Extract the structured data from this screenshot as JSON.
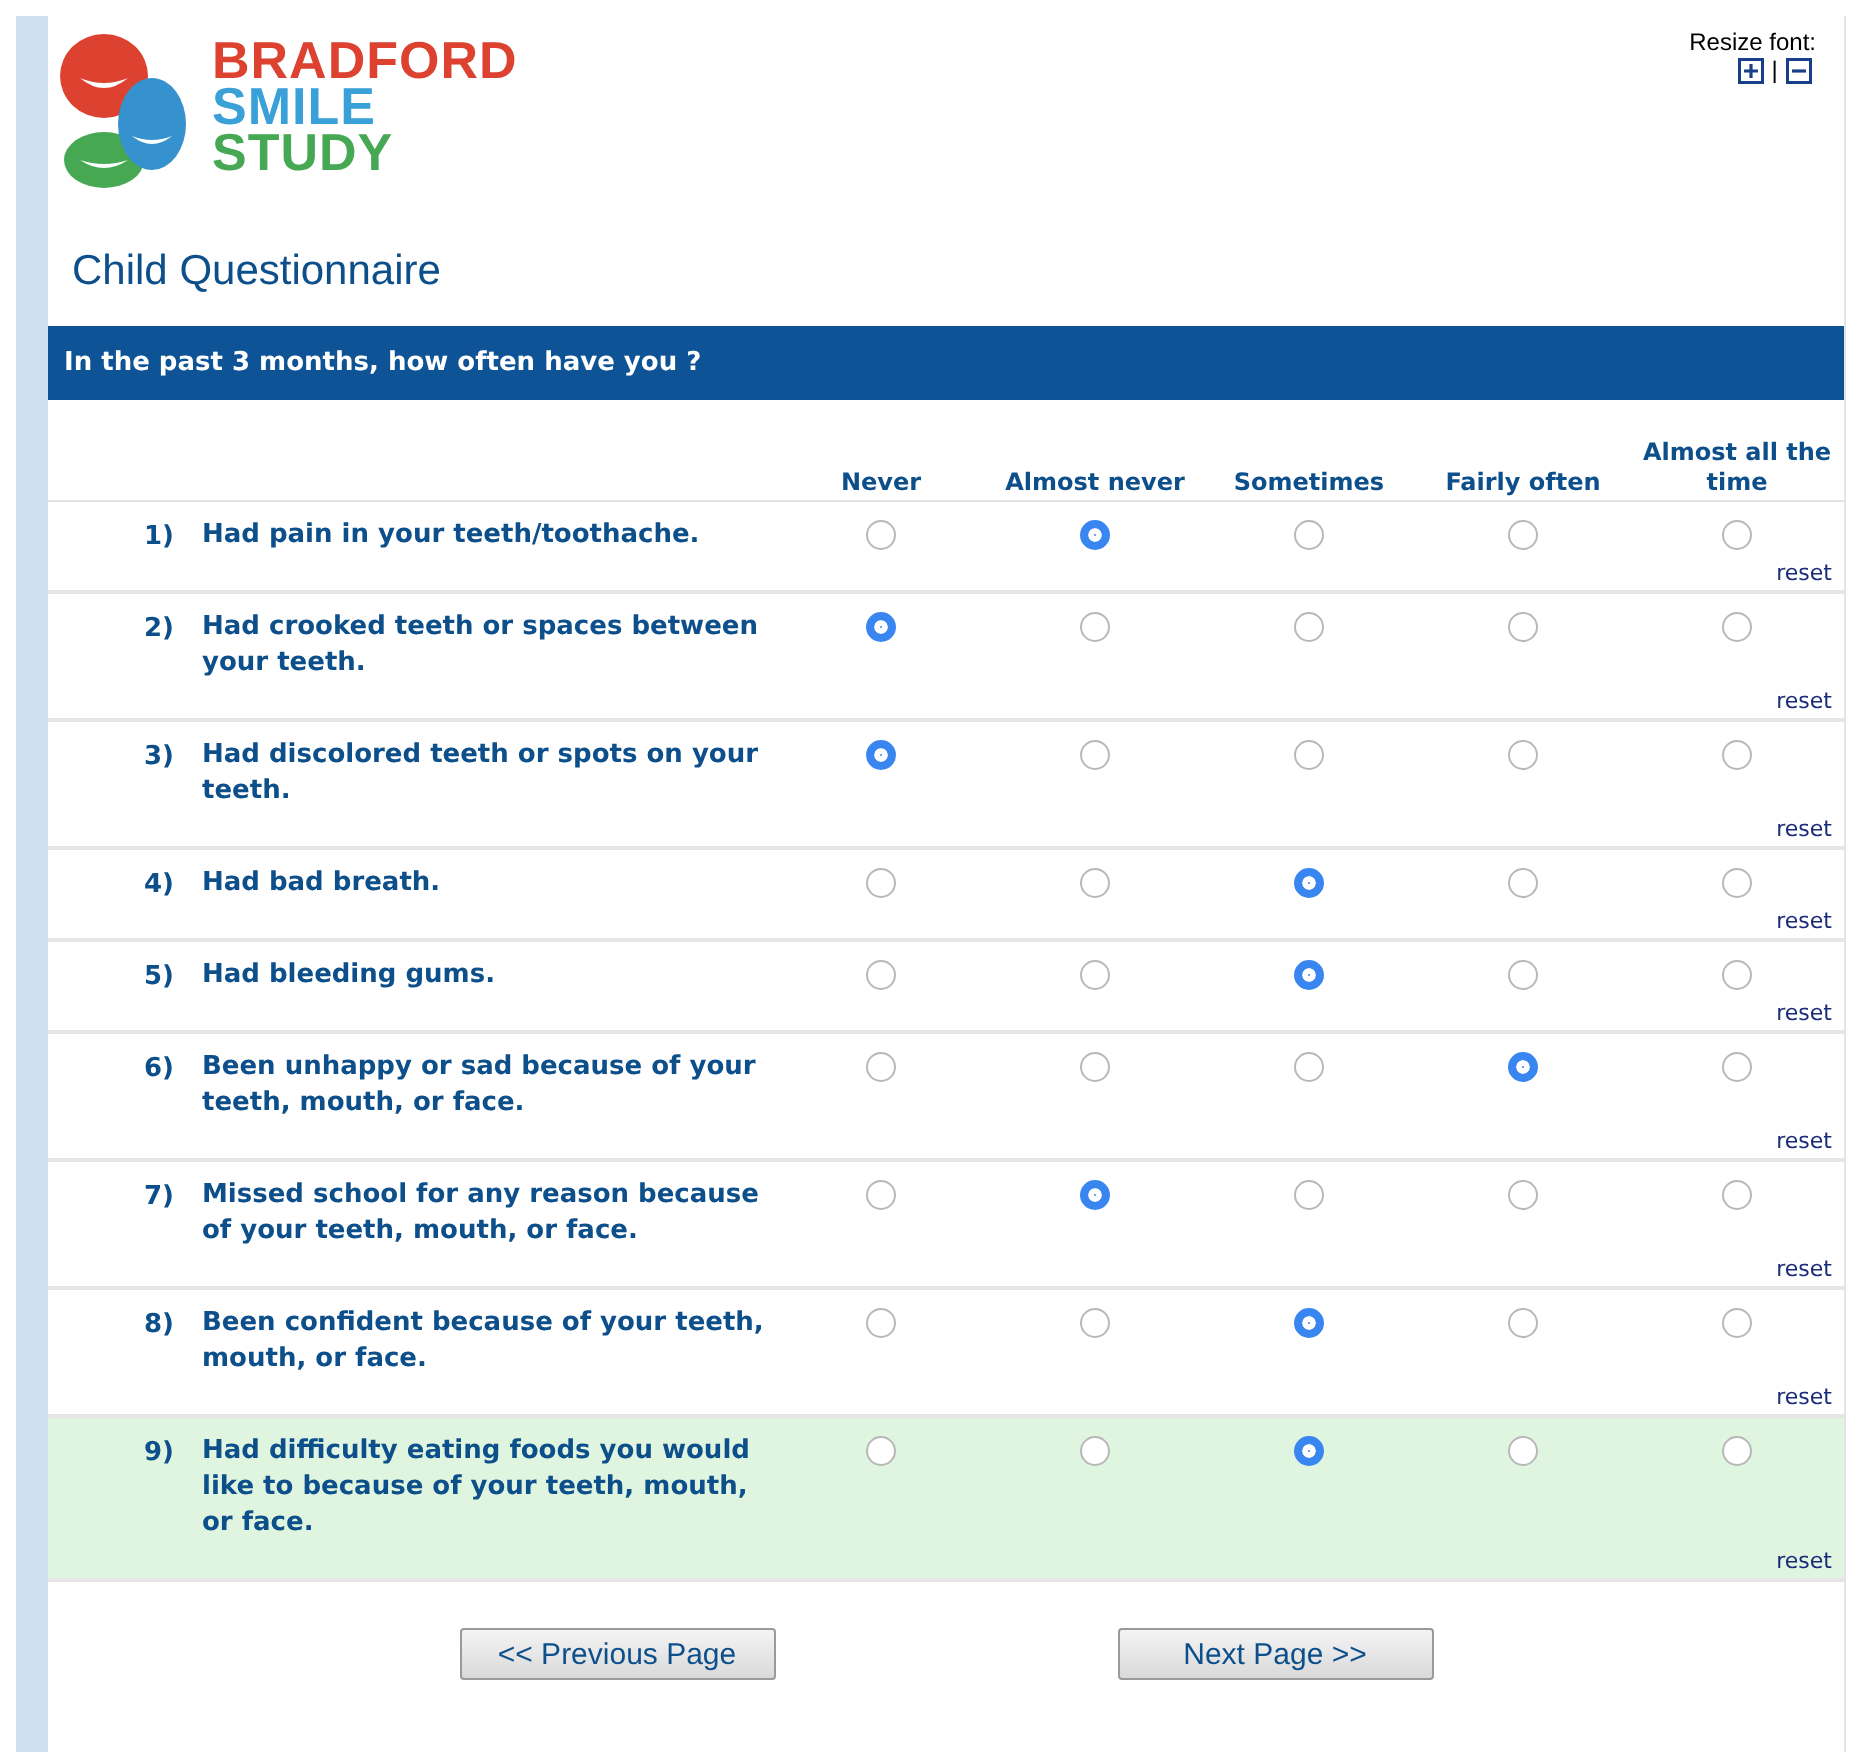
{
  "logo": {
    "lines": [
      "BRADFORD",
      "SMILE",
      "STUDY"
    ]
  },
  "resize_font": {
    "label": "Resize font:",
    "separator": "|"
  },
  "title": "Child Questionnaire",
  "section": {
    "heading": "In the past 3 months, how often have you ?"
  },
  "columns": [
    "Never",
    "Almost never",
    "Sometimes",
    "Fairly often",
    "Almost all the time"
  ],
  "rows": [
    {
      "number": "1)",
      "question": "Had pain in your teeth/toothache.",
      "highlighted": false,
      "choices": [
        {
          "selected": false
        },
        {
          "selected": true
        },
        {
          "selected": false
        },
        {
          "selected": false
        },
        {
          "selected": false
        }
      ],
      "reset": "reset"
    },
    {
      "number": "2)",
      "question": "Had crooked teeth or spaces between your teeth.",
      "highlighted": false,
      "choices": [
        {
          "selected": true
        },
        {
          "selected": false
        },
        {
          "selected": false
        },
        {
          "selected": false
        },
        {
          "selected": false
        }
      ],
      "reset": "reset"
    },
    {
      "number": "3)",
      "question": "Had discolored teeth or spots on your teeth.",
      "highlighted": false,
      "choices": [
        {
          "selected": true
        },
        {
          "selected": false
        },
        {
          "selected": false
        },
        {
          "selected": false
        },
        {
          "selected": false
        }
      ],
      "reset": "reset"
    },
    {
      "number": "4)",
      "question": "Had bad breath.",
      "highlighted": false,
      "choices": [
        {
          "selected": false
        },
        {
          "selected": false
        },
        {
          "selected": true
        },
        {
          "selected": false
        },
        {
          "selected": false
        }
      ],
      "reset": "reset"
    },
    {
      "number": "5)",
      "question": "Had bleeding gums.",
      "highlighted": false,
      "choices": [
        {
          "selected": false
        },
        {
          "selected": false
        },
        {
          "selected": true
        },
        {
          "selected": false
        },
        {
          "selected": false
        }
      ],
      "reset": "reset"
    },
    {
      "number": "6)",
      "question": "Been unhappy or sad because of your teeth, mouth, or face.",
      "highlighted": false,
      "choices": [
        {
          "selected": false
        },
        {
          "selected": false
        },
        {
          "selected": false
        },
        {
          "selected": true
        },
        {
          "selected": false
        }
      ],
      "reset": "reset"
    },
    {
      "number": "7)",
      "question": "Missed school for any reason because of your teeth, mouth, or face.",
      "highlighted": false,
      "choices": [
        {
          "selected": false
        },
        {
          "selected": true
        },
        {
          "selected": false
        },
        {
          "selected": false
        },
        {
          "selected": false
        }
      ],
      "reset": "reset"
    },
    {
      "number": "8)",
      "question": "Been confident because of your teeth, mouth, or face.",
      "highlighted": false,
      "choices": [
        {
          "selected": false
        },
        {
          "selected": false
        },
        {
          "selected": true
        },
        {
          "selected": false
        },
        {
          "selected": false
        }
      ],
      "reset": "reset"
    },
    {
      "number": "9)",
      "question": "Had difficulty eating foods you would like to because of your teeth, mouth, or face.",
      "highlighted": true,
      "choices": [
        {
          "selected": false
        },
        {
          "selected": false
        },
        {
          "selected": true
        },
        {
          "selected": false
        },
        {
          "selected": false
        }
      ],
      "reset": "reset"
    }
  ],
  "buttons": [
    {
      "label": "<< Previous Page"
    },
    {
      "label": "Next Page >>"
    }
  ]
}
